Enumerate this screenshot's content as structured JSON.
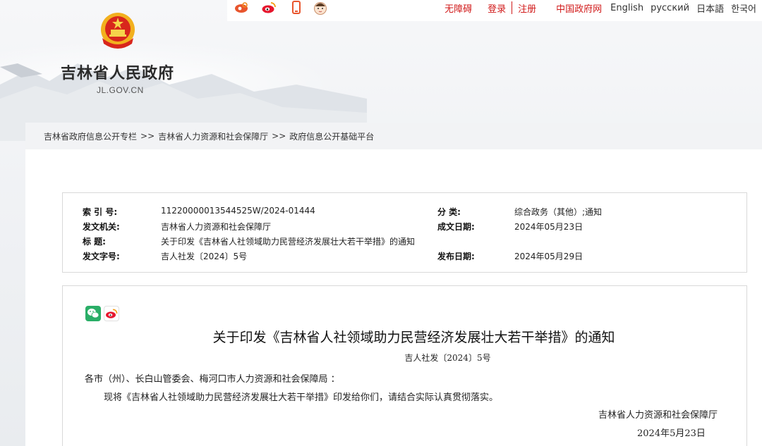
{
  "colors": {
    "accent": "#d11a1a",
    "panel": "#ffffff",
    "border": "#d9d9d9"
  },
  "header": {
    "top_icons": [
      "weibo-alt-icon",
      "weibo-icon",
      "mobile-icon",
      "child-avatar-icon"
    ],
    "links": {
      "accessibility": "无障碍",
      "login": "登录",
      "register": "注册",
      "gov_cn": "中国政府网",
      "english": "English",
      "russian": "русский",
      "japanese": "日本語",
      "korean": "한국어"
    },
    "site_title": "吉林省人民政府",
    "site_domain": "JL.GOV.CN"
  },
  "breadcrumb": {
    "items": [
      "吉林省政府信息公开专栏",
      "吉林省人力资源和社会保障厅",
      "政府信息公开基础平台"
    ],
    "separator": ">>"
  },
  "info": {
    "index_label": "索 引 号:",
    "index_value": "11220000013544525W/2024-01444",
    "category_label": "分 类:",
    "category_value": "综合政务（其他）;通知",
    "issuer_label": "发文机关:",
    "issuer_value": "吉林省人力资源和社会保障厅",
    "created_label": "成文日期:",
    "created_value": "2024年05月23日",
    "title_label": "标 题:",
    "title_value": "关于印发《吉林省人社领域助力民营经济发展壮大若干举措》的通知",
    "docno_label": "发文字号:",
    "docno_value": "吉人社发〔2024〕5号",
    "published_label": "发布日期:",
    "published_value": "2024年05月29日"
  },
  "article": {
    "share_icons": [
      "wechat-icon",
      "weibo-icon"
    ],
    "title": "关于印发《吉林省人社领域助力民营经济发展壮大若干举措》的通知",
    "doc_number": "吉人社发〔2024〕5号",
    "salutation": "各市（州）、长白山管委会、梅河口市人力资源和社会保障局 ：",
    "body": "现将《吉林省人社领域助力民营经济发展壮大若干举措》印发给你们，请结合实际认真贯彻落实。",
    "signature": "吉林省人力资源和社会保障厅",
    "date": "2024年5月23日"
  }
}
